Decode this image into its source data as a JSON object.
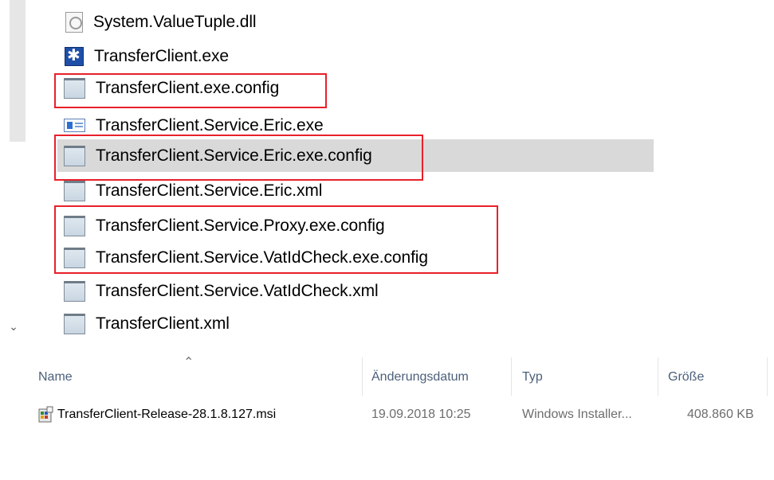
{
  "explorer": {
    "files": [
      {
        "name": "System.ValueTuple.dll",
        "icon": "dll-file-icon"
      },
      {
        "name": "TransferClient.exe",
        "icon": "exe-app-icon"
      },
      {
        "name": "TransferClient.exe.config",
        "icon": "config-file-icon"
      },
      {
        "name": "TransferClient.Service.Eric.exe",
        "icon": "service-exe-icon"
      },
      {
        "name": "TransferClient.Service.Eric.exe.config",
        "icon": "config-file-icon"
      },
      {
        "name": "TransferClient.Service.Eric.xml",
        "icon": "xml-file-icon"
      },
      {
        "name": "TransferClient.Service.Proxy.exe.config",
        "icon": "config-file-icon"
      },
      {
        "name": "TransferClient.Service.VatIdCheck.exe.config",
        "icon": "config-file-icon"
      },
      {
        "name": "TransferClient.Service.VatIdCheck.xml",
        "icon": "xml-file-icon"
      },
      {
        "name": "TransferClient.xml",
        "icon": "xml-file-icon"
      }
    ],
    "highlight_color": "#e8202a",
    "selected_row_color": "#d9d9d9"
  },
  "list_view": {
    "columns": {
      "name": "Name",
      "date": "Änderungsdatum",
      "type": "Typ",
      "size": "Größe"
    },
    "rows": [
      {
        "name": "TransferClient-Release-28.1.8.127.msi",
        "date": "19.09.2018 10:25",
        "type": "Windows Installer...",
        "size": "408.860 KB",
        "icon": "msi-installer-icon"
      }
    ]
  }
}
